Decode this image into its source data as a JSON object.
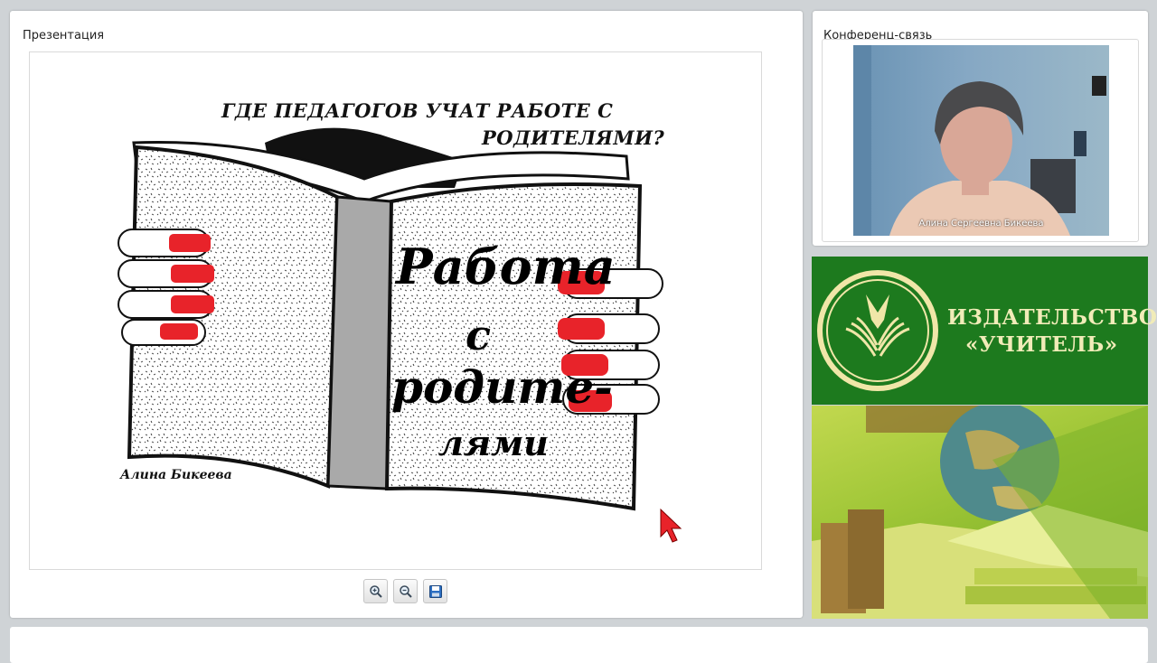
{
  "presentation": {
    "title": "Презентация",
    "slide": {
      "heading_line1": "ГДЕ ПЕДАГОГОВ УЧАТ РАБОТЕ С",
      "heading_line2": "РОДИТЕЛЯМИ?",
      "book_word1": "Работа",
      "book_word2": "с",
      "book_word3": "родите-",
      "book_word4": "лями",
      "author": "Алина Бикеева"
    },
    "toolbar": {
      "zoom_in_icon": "zoom-in-icon",
      "zoom_out_icon": "zoom-out-icon",
      "save_icon": "floppy-disk-icon"
    }
  },
  "conference": {
    "title": "Конференц-связь",
    "participant_name": "Алина Сергеевна Бикеева"
  },
  "publisher": {
    "line1": "ИЗДАТЕЛЬСТВО",
    "line2": "«УЧИТЕЛЬ»"
  },
  "colors": {
    "publisher_green": "#1d7a1e",
    "publisher_text": "#f1ecb8",
    "nail_red": "#e8232a"
  }
}
